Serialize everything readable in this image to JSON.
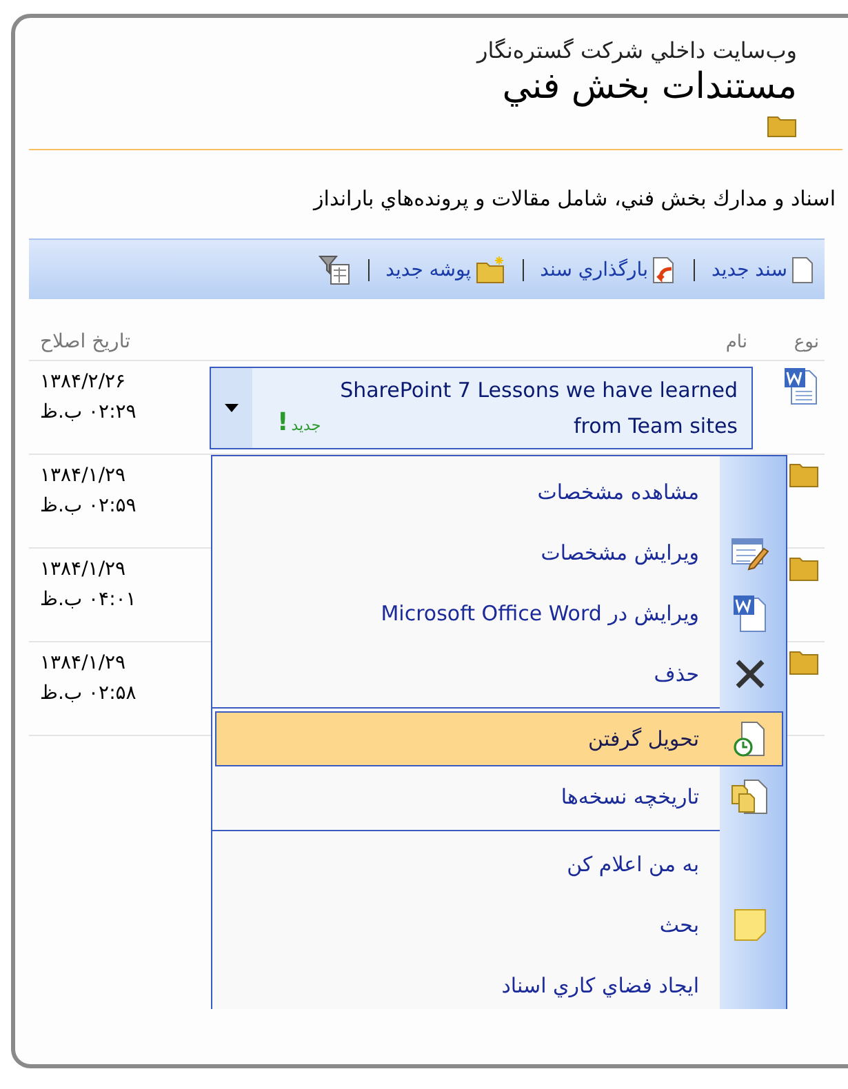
{
  "site_title": "وب‌سايت داخلي شركت گستره‌نگار",
  "page_title": "مستندات بخش فني",
  "description": "اسناد و مدارك بخش فني، شامل مقالات و پرونده‌هاي بارانداز",
  "toolbar": [
    {
      "label": "سند جديد",
      "kind": "new-document"
    },
    {
      "label": "بارگذاري سند",
      "kind": "upload"
    },
    {
      "label": "پوشه جديد",
      "kind": "new-folder"
    },
    {
      "kind": "filter"
    }
  ],
  "columns": [
    "نوع",
    "نام",
    "تاريخ اصلاح"
  ],
  "rows": [
    {
      "kind": "document",
      "selected": true,
      "name": "SharePoint 7 Lessons we have learned from Team sites",
      "new_label": "جديد",
      "new_mark": "!",
      "date": "۱۳۸۴/۲/۲۶",
      "time": "۰۲:۲۹ ب.ظ"
    },
    {
      "kind": "folder",
      "selected": false,
      "date": "۱۳۸۴/۱/۲۹",
      "time": "۰۲:۵۹ ب.ظ"
    },
    {
      "kind": "folder",
      "selected": false,
      "date": "۱۳۸۴/۱/۲۹",
      "time": "۰۴:۰۱ ب.ظ"
    },
    {
      "kind": "folder",
      "selected": false,
      "date": "۱۳۸۴/۱/۲۹",
      "time": "۰۲:۵۸ ب.ظ"
    }
  ],
  "menu": [
    [
      {
        "label": "مشاهده مشخصات",
        "selected": false
      },
      {
        "label": "ويرايش مشخصات",
        "selected": false
      },
      {
        "label": "ويرايش در Microsoft Office Word",
        "selected": false
      },
      {
        "label": "حذف",
        "selected": false
      }
    ],
    [
      {
        "label": "تحويل گرفتن",
        "selected": true
      },
      {
        "label": "تاريخچه نسخه‌ها",
        "selected": false
      }
    ],
    [
      {
        "label": "به من اعلام كن",
        "selected": false
      },
      {
        "label": "بحث",
        "selected": false
      },
      {
        "label": "ايجاد فضاي كاري اسناد",
        "selected": false
      }
    ]
  ]
}
